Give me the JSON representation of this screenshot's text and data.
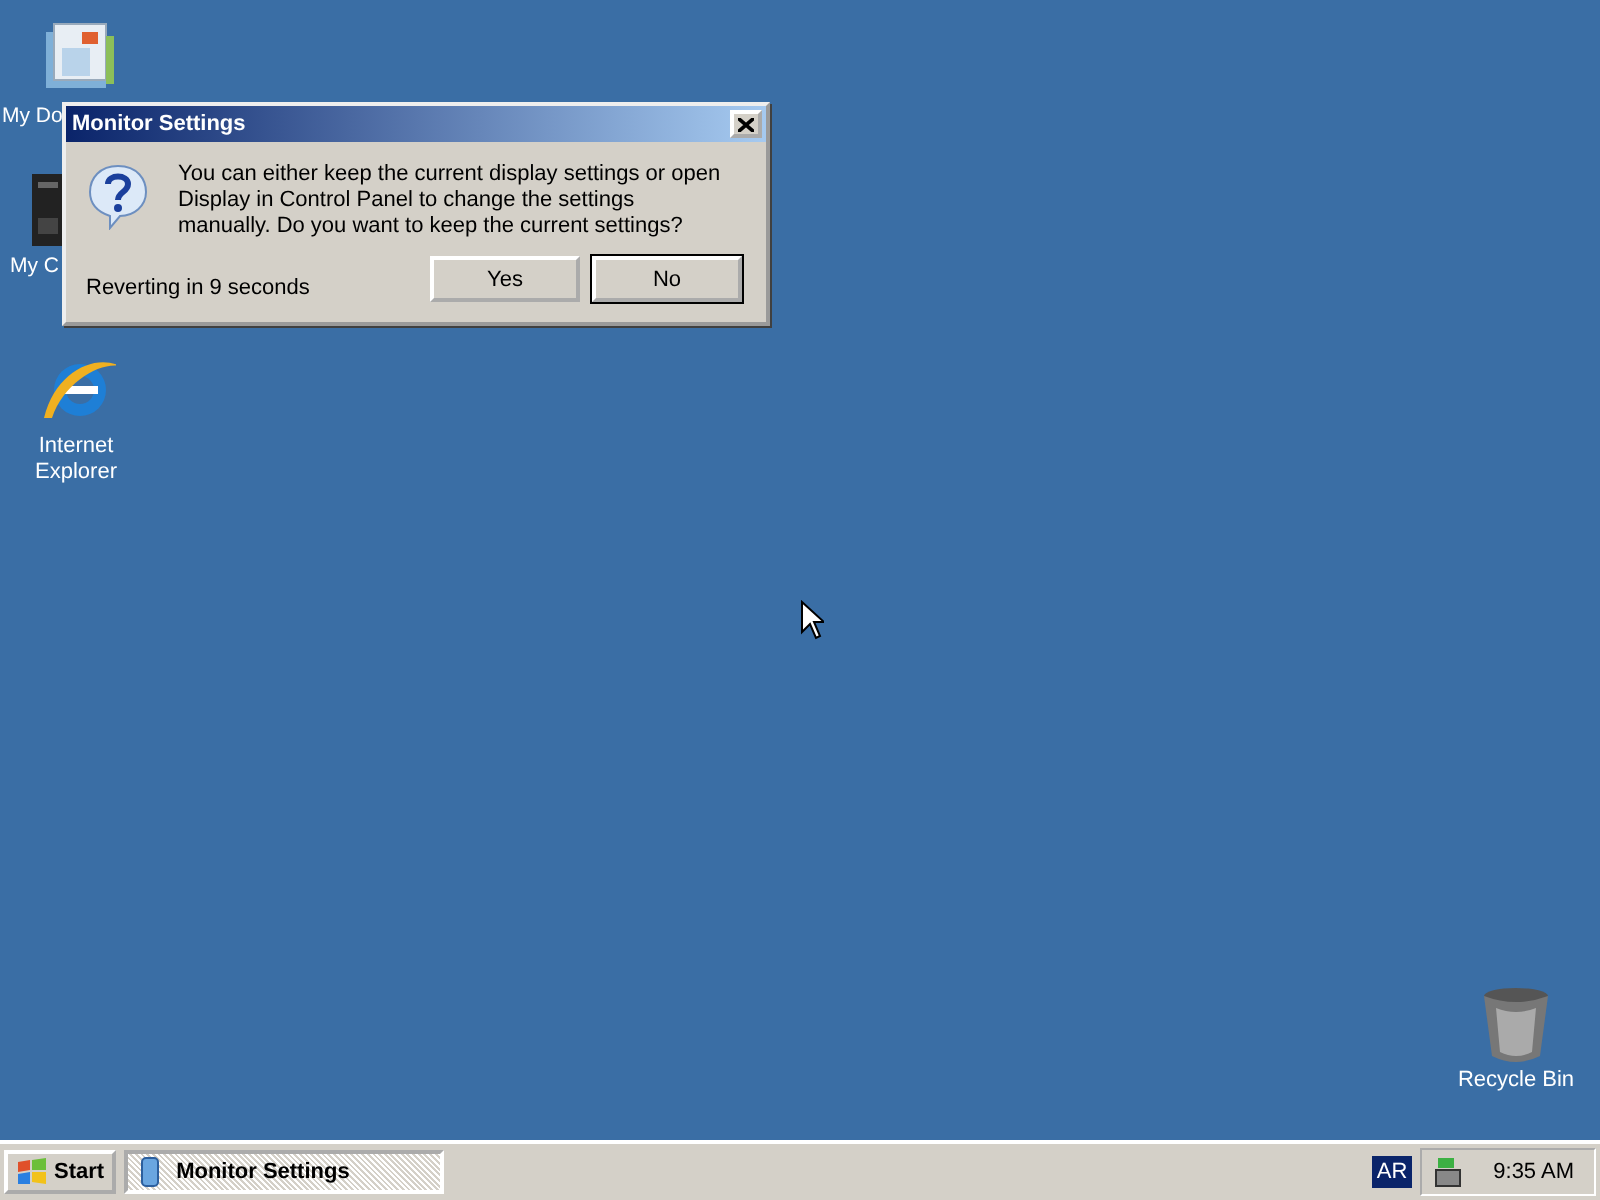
{
  "desktop_icons": [
    {
      "label": "My Do",
      "kind": "documents"
    },
    {
      "label": "My C",
      "kind": "computer"
    },
    {
      "label": "Internet Explorer",
      "kind": "browser"
    },
    {
      "label": "Recycle Bin",
      "kind": "bin"
    }
  ],
  "dialog": {
    "title": "Monitor Settings",
    "message": "You can either keep the current display settings or open Display in Control Panel to change the settings manually. Do you want to keep the current settings?",
    "countdown": "Reverting in 9 seconds",
    "buttons": [
      {
        "label": "Yes",
        "selected": false
      },
      {
        "label": "No",
        "selected": true
      }
    ]
  },
  "taskbar": {
    "start": "Start",
    "tasks": [
      {
        "label": "Monitor Settings",
        "selected": true
      }
    ],
    "language": "AR",
    "clock": "9:35 AM"
  }
}
